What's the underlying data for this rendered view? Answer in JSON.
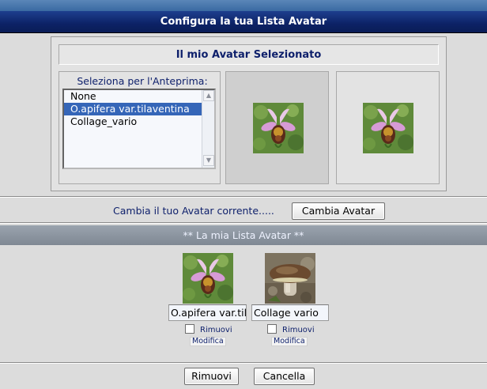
{
  "window": {
    "title": "Configura la tua Lista Avatar"
  },
  "selected_avatar": {
    "heading": "Il mio Avatar Selezionato",
    "select_label": "Seleziona per l'Anteprima:",
    "options": [
      "None",
      "O.apifera var.tilaventina",
      "Collage_vario"
    ],
    "selected_option": "O.apifera var.tilaventina"
  },
  "change": {
    "text": "Cambia il tuo Avatar corrente.....",
    "button_label": "Cambia Avatar"
  },
  "list": {
    "heading": "** La mia Lista Avatar **",
    "items": [
      {
        "name": "O.apifera var.tilaventina",
        "remove_label": "Rimuovi",
        "edit_label": "Modifica",
        "image": "orchid-image"
      },
      {
        "name": "Collage vario",
        "remove_label": "Rimuovi",
        "edit_label": "Modifica",
        "image": "mushroom-image"
      }
    ]
  },
  "footer": {
    "remove_label": "Rimuovi",
    "cancel_label": "Cancella"
  },
  "icons": {
    "scroll_up": "scroll-up-arrow-icon",
    "scroll_down": "scroll-down-arrow-icon"
  },
  "colors": {
    "title_bg": "#0c2266",
    "label_text": "#0d1f6b",
    "selection": "#3566b8",
    "list_bar": "#8a939e"
  }
}
